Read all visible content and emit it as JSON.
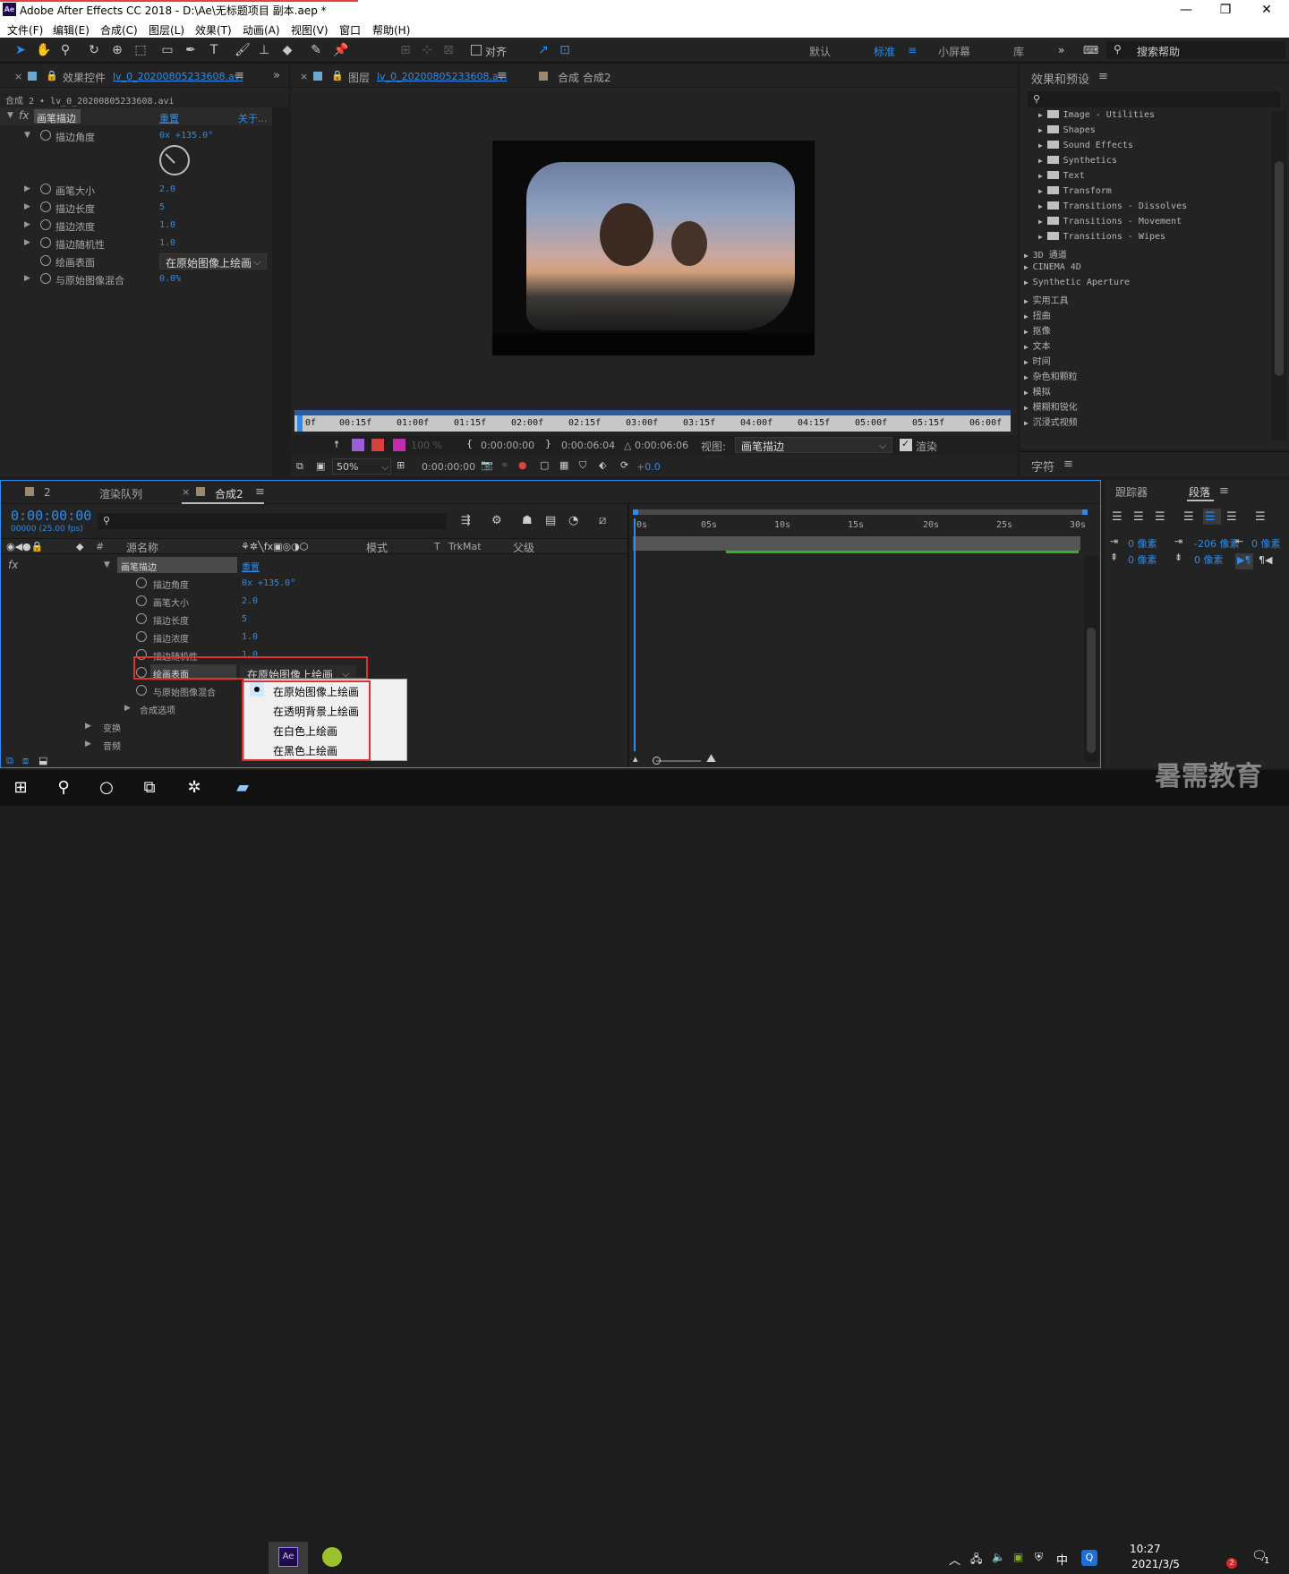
{
  "app": {
    "title": "Adobe After Effects CC 2018 - D:\\Ae\\无标题项目 副本.aep *",
    "logo": "Ae"
  },
  "window_controls": {
    "minimize": "—",
    "restore": "❐",
    "close": "✕"
  },
  "menu": [
    "文件(F)",
    "编辑(E)",
    "合成(C)",
    "图层(L)",
    "效果(T)",
    "动画(A)",
    "视图(V)",
    "窗口",
    "帮助(H)"
  ],
  "toolbar": {
    "align_label": "对齐",
    "workspaces": [
      "默认",
      "标准",
      "小屏幕",
      "库"
    ],
    "active_workspace": "标准",
    "search_placeholder": "搜索帮助"
  },
  "effect_controls": {
    "tab": "效果控件",
    "tab_file": "lv_0_20200805233608.avi",
    "breadcrumb": "合成 2 • lv_0_20200805233608.avi",
    "effect_name": "画笔描边",
    "reset": "重置",
    "about": "关于...",
    "props": [
      {
        "name": "描边角度",
        "value": "0x +135.0°"
      },
      {
        "name": "画笔大小",
        "value": "2.0"
      },
      {
        "name": "描边长度",
        "value": "5"
      },
      {
        "name": "描边浓度",
        "value": "1.0"
      },
      {
        "name": "描边随机性",
        "value": "1.0"
      },
      {
        "name": "绘画表面",
        "value": "在原始图像上绘画"
      },
      {
        "name": "与原始图像混合",
        "value": "0.0%"
      }
    ]
  },
  "viewer": {
    "tab_layer": "图层",
    "tab_layer_file": "lv_0_20200805233608.avi",
    "tab_comp": "合成 合成2",
    "ruler": [
      "0f",
      "00:15f",
      "01:00f",
      "01:15f",
      "02:00f",
      "02:15f",
      "03:00f",
      "03:15f",
      "04:00f",
      "04:15f",
      "05:00f",
      "05:15f",
      "06:00f"
    ],
    "opacity": "100 %",
    "time_in": "0:00:00:00",
    "time_out": "0:00:06:04",
    "duration": "△ 0:00:06:06",
    "view_label": "视图:",
    "view_value": "画笔描边",
    "render_label": "渲染",
    "zoom": "50%",
    "time_current": "0:00:00:00",
    "exposure": "+0.0"
  },
  "effects_presets": {
    "title": "效果和预设",
    "search_placeholder": "",
    "items": [
      {
        "label": "Image - Utilities",
        "folder": true
      },
      {
        "label": "Shapes",
        "folder": true
      },
      {
        "label": "Sound Effects",
        "folder": true
      },
      {
        "label": "Synthetics",
        "folder": true
      },
      {
        "label": "Text",
        "folder": true
      },
      {
        "label": "Transform",
        "folder": true
      },
      {
        "label": "Transitions - Dissolves",
        "folder": true
      },
      {
        "label": "Transitions - Movement",
        "folder": true
      },
      {
        "label": "Transitions - Wipes",
        "folder": true
      },
      {
        "label": "3D 通道",
        "folder": false
      },
      {
        "label": "CINEMA 4D",
        "folder": false
      },
      {
        "label": "Synthetic Aperture",
        "folder": false
      },
      {
        "label": "实用工具",
        "folder": false
      },
      {
        "label": "扭曲",
        "folder": false
      },
      {
        "label": "抠像",
        "folder": false
      },
      {
        "label": "文本",
        "folder": false
      },
      {
        "label": "时间",
        "folder": false
      },
      {
        "label": "杂色和颗粒",
        "folder": false
      },
      {
        "label": "模拟",
        "folder": false
      },
      {
        "label": "模糊和锐化",
        "folder": false
      },
      {
        "label": "沉浸式视频",
        "folder": false
      }
    ],
    "character_tab": "字符"
  },
  "timeline": {
    "tabs": [
      "2",
      "渲染队列",
      "合成2"
    ],
    "timecode": "0:00:00:00",
    "fps": "00000 (25.00 fps)",
    "headers": {
      "source": "源名称",
      "mode": "模式",
      "t": "T",
      "trkmat": "TrkMat",
      "parent": "父级"
    },
    "effect_row": {
      "name": "画笔描边",
      "reset": "重置"
    },
    "props": [
      {
        "name": "描边角度",
        "value": "0x +135.0°"
      },
      {
        "name": "画笔大小",
        "value": "2.0"
      },
      {
        "name": "描边长度",
        "value": "5"
      },
      {
        "name": "描边浓度",
        "value": "1.0"
      },
      {
        "name": "描边随机性",
        "value": "1.0"
      }
    ],
    "surface": {
      "name": "绘画表面",
      "value": "在原始图像上绘画"
    },
    "blend": {
      "name": "与原始图像混合"
    },
    "composite": "合成选项",
    "transform": "变换",
    "audio": "音频",
    "ruler": [
      "0s",
      "05s",
      "10s",
      "15s",
      "20s",
      "25s",
      "30s"
    ]
  },
  "dropdown": {
    "options": [
      "在原始图像上绘画",
      "在透明背景上绘画",
      "在白色上绘画",
      "在黑色上绘画"
    ],
    "selected": 0
  },
  "right_panel": {
    "tabs": [
      "跟踪器",
      "段落"
    ],
    "indent_left": "0 像素",
    "indent_first": "-206 像素",
    "indent_right": "0 像素",
    "space_before": "0 像素",
    "space_after": "0 像素"
  },
  "taskbar": {
    "time": "10:27",
    "date": "2021/3/5",
    "ime": "中",
    "notif": "1",
    "badge": "2"
  },
  "watermark": "暑需教育",
  "colors": {
    "accent": "#2d8ceb",
    "highlight_red": "#e03030",
    "green_bar": "#2cb52c"
  }
}
